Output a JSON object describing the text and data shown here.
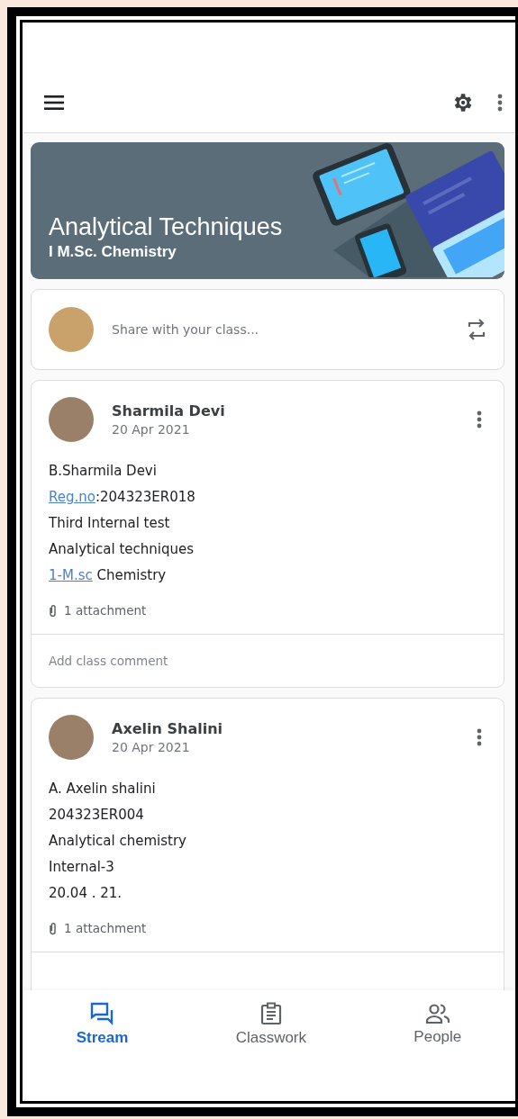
{
  "banner": {
    "title": "Analytical Techniques",
    "subtitle": "I M.Sc. Chemistry"
  },
  "share": {
    "placeholder": "Share with your class..."
  },
  "posts": [
    {
      "author": "Sharmila Devi",
      "date": "20 Apr 2021",
      "lines": [
        [
          {
            "text": "B.Sharmila Devi",
            "link": false
          }
        ],
        [
          {
            "text": "Reg.no",
            "link": true
          },
          {
            "text": ":204323ER018",
            "link": false
          }
        ],
        [
          {
            "text": "Third Internal test",
            "link": false
          }
        ],
        [
          {
            "text": "Analytical techniques",
            "link": false
          }
        ],
        [
          {
            "text": "1-M.sc",
            "link": true
          },
          {
            "text": " Chemistry",
            "link": false
          }
        ]
      ],
      "attachment": "1 attachment",
      "comment_placeholder": "Add class comment"
    },
    {
      "author": "Axelin Shalini",
      "date": "20 Apr 2021",
      "lines": [
        [
          {
            "text": "A. Axelin shalini",
            "link": false
          }
        ],
        [
          {
            "text": "204323ER004",
            "link": false
          }
        ],
        [
          {
            "text": "Analytical chemistry",
            "link": false
          }
        ],
        [
          {
            "text": "Internal-3",
            "link": false
          }
        ],
        [
          {
            "text": "20.04 . 21.",
            "link": false
          }
        ]
      ],
      "attachment": "1 attachment"
    }
  ],
  "nav": [
    {
      "label": "Stream",
      "kind": "stream",
      "selected": true
    },
    {
      "label": "Classwork",
      "kind": "classwork",
      "selected": false
    },
    {
      "label": "People",
      "kind": "people",
      "selected": false
    }
  ]
}
